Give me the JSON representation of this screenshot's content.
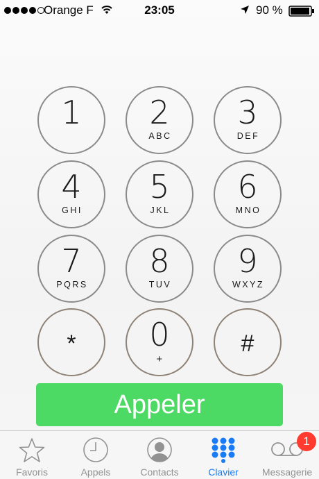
{
  "status_bar": {
    "carrier": "Orange F",
    "time": "23:05",
    "battery_percent": "90 %",
    "signal_bars": 4,
    "signal_max": 5
  },
  "keypad": {
    "keys": [
      {
        "digit": "1",
        "letters": ""
      },
      {
        "digit": "2",
        "letters": "ABC"
      },
      {
        "digit": "3",
        "letters": "DEF"
      },
      {
        "digit": "4",
        "letters": "GHI"
      },
      {
        "digit": "5",
        "letters": "JKL"
      },
      {
        "digit": "6",
        "letters": "MNO"
      },
      {
        "digit": "7",
        "letters": "PQRS"
      },
      {
        "digit": "8",
        "letters": "TUV"
      },
      {
        "digit": "9",
        "letters": "WXYZ"
      },
      {
        "digit": "*",
        "letters": ""
      },
      {
        "digit": "0",
        "letters": "+"
      },
      {
        "digit": "#",
        "letters": ""
      }
    ]
  },
  "call_button": {
    "label": "Appeler",
    "color": "#4cd964"
  },
  "tab_bar": {
    "tabs": [
      {
        "label": "Favoris",
        "icon": "star-icon",
        "active": false
      },
      {
        "label": "Appels",
        "icon": "clock-icon",
        "active": false
      },
      {
        "label": "Contacts",
        "icon": "contact-icon",
        "active": false
      },
      {
        "label": "Clavier",
        "icon": "keypad-icon",
        "active": true
      },
      {
        "label": "Messagerie",
        "icon": "voicemail-icon",
        "active": false
      }
    ],
    "voicemail_badge": "1",
    "active_color": "#1a7cf5",
    "badge_color": "#ff3b30"
  }
}
